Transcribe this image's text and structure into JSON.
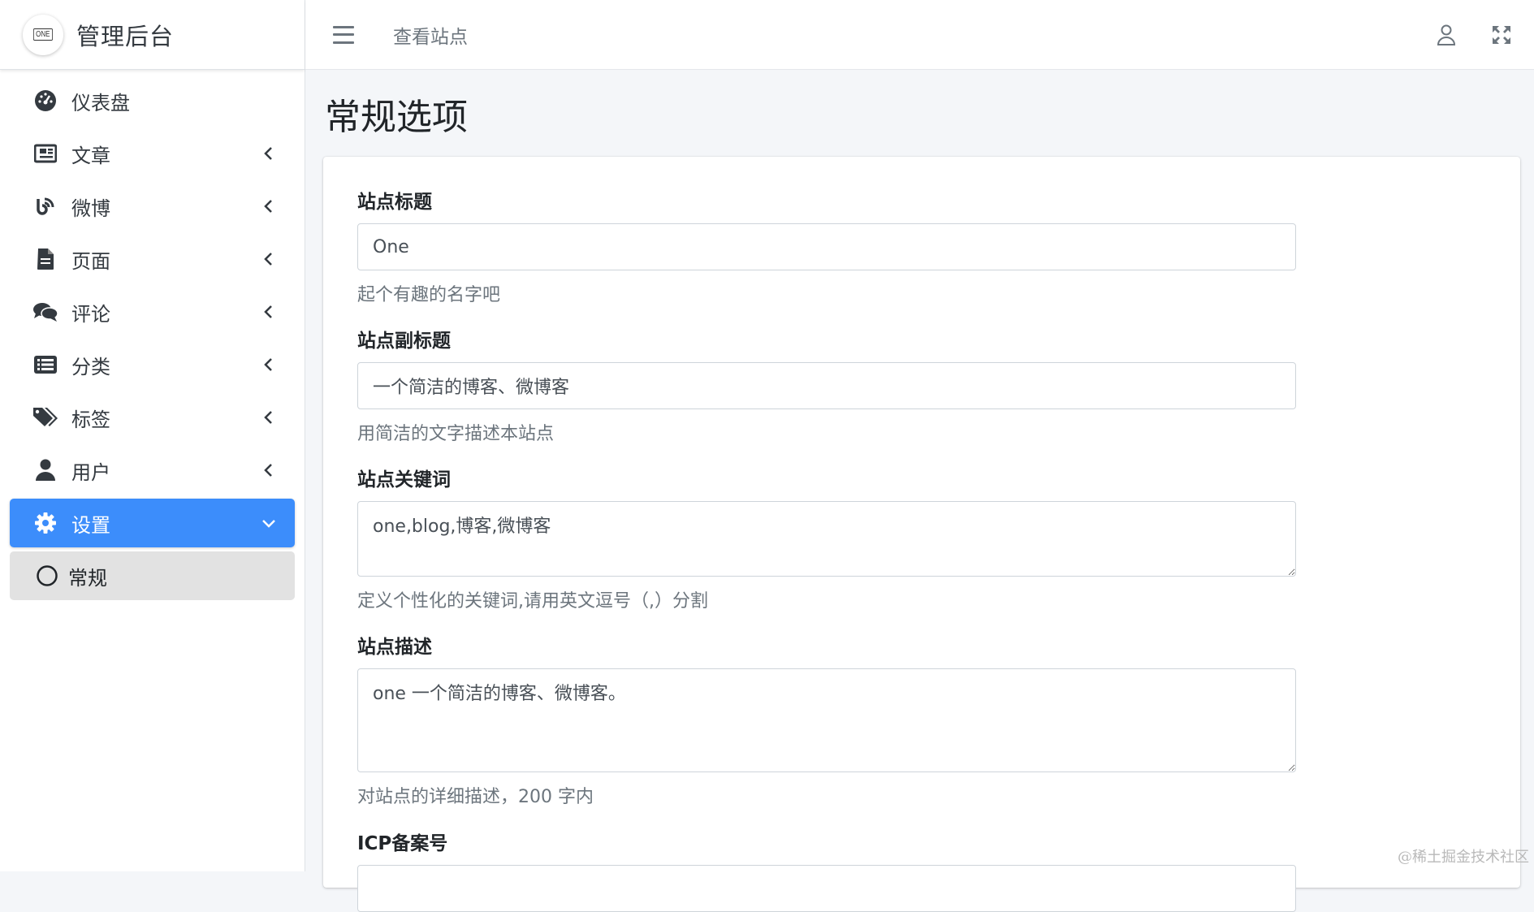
{
  "brand": {
    "logo_text": "ONE",
    "title": "管理后台"
  },
  "sidebar": {
    "items": [
      {
        "label": "仪表盘",
        "icon": "tachometer-icon",
        "has_children": false
      },
      {
        "label": "文章",
        "icon": "newspaper-icon",
        "has_children": true
      },
      {
        "label": "微博",
        "icon": "blog-icon",
        "has_children": true
      },
      {
        "label": "页面",
        "icon": "file-icon",
        "has_children": true
      },
      {
        "label": "评论",
        "icon": "comments-icon",
        "has_children": true
      },
      {
        "label": "分类",
        "icon": "list-icon",
        "has_children": true
      },
      {
        "label": "标签",
        "icon": "tags-icon",
        "has_children": true
      },
      {
        "label": "用户",
        "icon": "user-icon",
        "has_children": true
      },
      {
        "label": "设置",
        "icon": "gear-icon",
        "has_children": true,
        "active": true,
        "expanded": true
      },
      {
        "label": "常规",
        "icon": "circle-icon",
        "sub": true,
        "selected": true
      }
    ]
  },
  "topbar": {
    "view_site_link": "查看站点"
  },
  "page": {
    "title": "常规选项"
  },
  "form": {
    "site_title": {
      "label": "站点标题",
      "value": "One",
      "help": "起个有趣的名字吧"
    },
    "site_subtitle": {
      "label": "站点副标题",
      "value": "一个简洁的博客、微博客",
      "help": "用简洁的文字描述本站点"
    },
    "site_keywords": {
      "label": "站点关键词",
      "value": "one,blog,博客,微博客",
      "help": "定义个性化的关键词,请用英文逗号（,）分割"
    },
    "site_description": {
      "label": "站点描述",
      "value": "one 一个简洁的博客、微博客。",
      "help": "对站点的详细描述，200 字内"
    },
    "icp": {
      "label": "ICP备案号"
    }
  },
  "watermark": "@稀土掘金技术社区",
  "colors": {
    "accent": "#3c8dfb",
    "sidebar_bg": "#ffffff",
    "content_bg": "#f4f6f9"
  }
}
